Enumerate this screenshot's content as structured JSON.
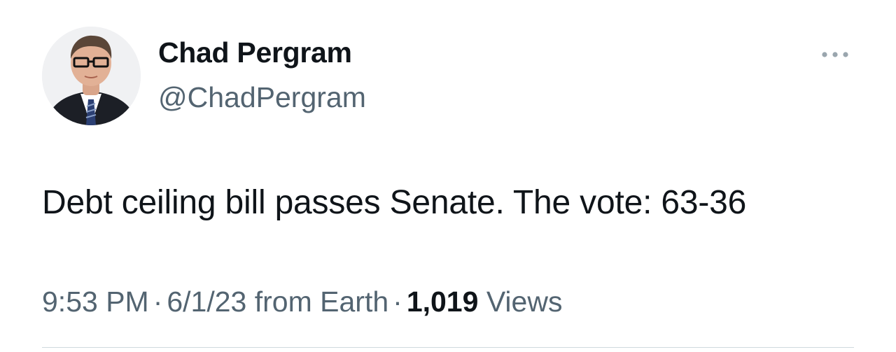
{
  "author": {
    "display_name": "Chad Pergram",
    "handle": "@ChadPergram"
  },
  "tweet": {
    "text": "Debt ceiling bill passes Senate. The vote: 63-36"
  },
  "meta": {
    "time": "9:53 PM",
    "separator": "·",
    "date": "6/1/23",
    "source": "from Earth",
    "views_count": "1,019",
    "views_label": "Views"
  },
  "icons": {
    "more": "more-horizontal-icon"
  },
  "colors": {
    "primary_text": "#0f1419",
    "secondary_text": "#536471",
    "divider": "#cfd9de",
    "background": "#ffffff"
  }
}
